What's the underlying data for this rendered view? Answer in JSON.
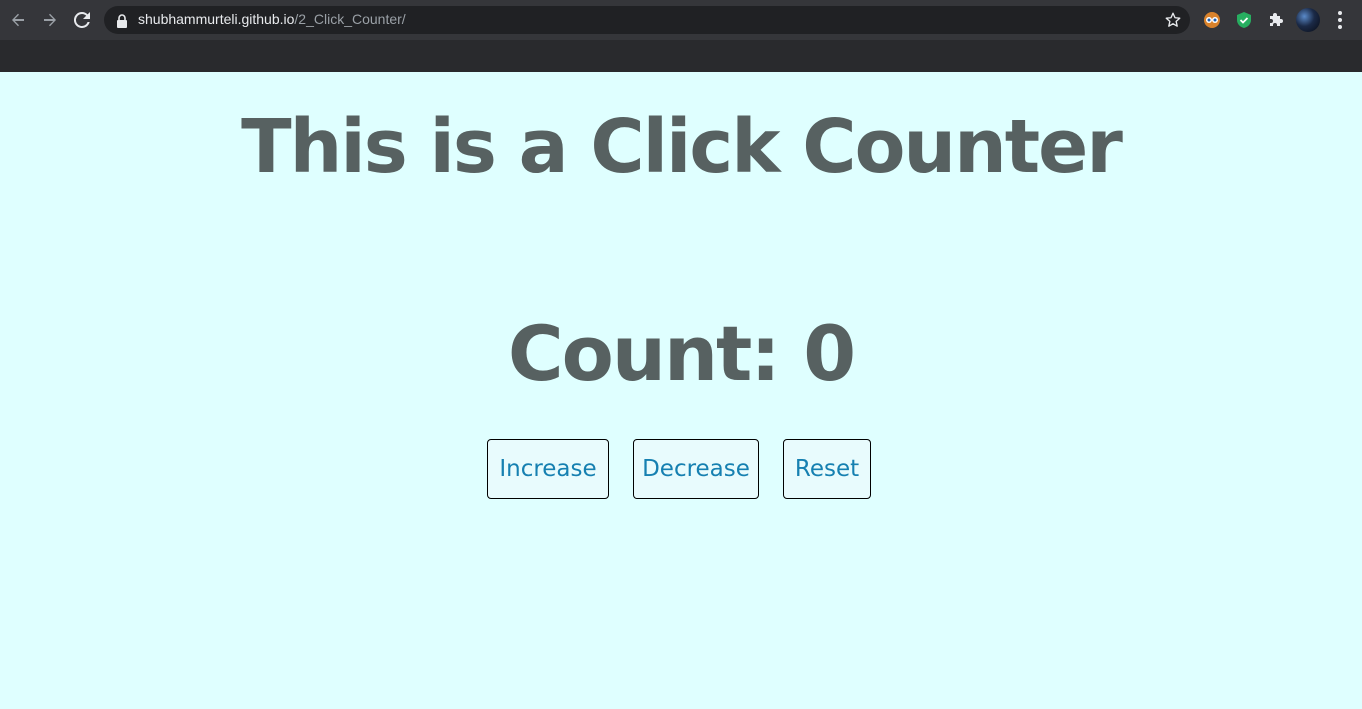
{
  "browser": {
    "url_host": "shubhammurteli.github.io",
    "url_path": "/2_Click_Counter/"
  },
  "page": {
    "title": "This is a Click Counter",
    "count_text": "Count: 0",
    "buttons": {
      "increase": "Increase",
      "decrease": "Decrease",
      "reset": "Reset"
    }
  },
  "colors": {
    "page_bg": "#dfffff",
    "text": "#576161",
    "button_text": "#1680b1"
  },
  "icons": [
    "back-icon",
    "forward-icon",
    "reload-icon",
    "lock-icon",
    "star-icon",
    "extension-eyes-icon",
    "shield-icon",
    "puzzle-icon",
    "avatar",
    "more-menu-icon"
  ]
}
